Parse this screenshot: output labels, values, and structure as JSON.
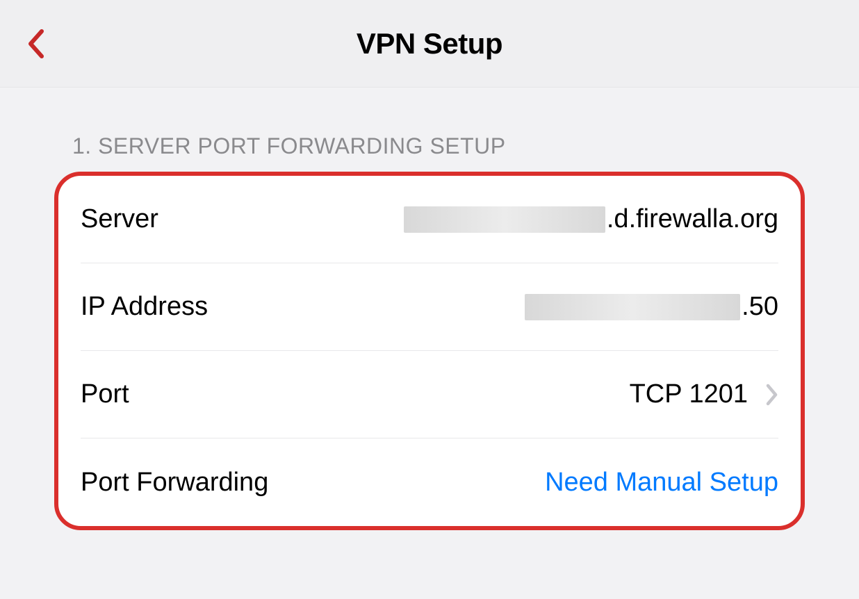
{
  "header": {
    "title": "VPN Setup"
  },
  "section": {
    "title": "1. SERVER PORT FORWARDING SETUP"
  },
  "rows": {
    "server": {
      "label": "Server",
      "value_suffix": ".d.firewalla.org"
    },
    "ip": {
      "label": "IP Address",
      "value_suffix": ".50"
    },
    "port": {
      "label": "Port",
      "value": "TCP 1201"
    },
    "forwarding": {
      "label": "Port Forwarding",
      "value": "Need Manual Setup"
    }
  }
}
